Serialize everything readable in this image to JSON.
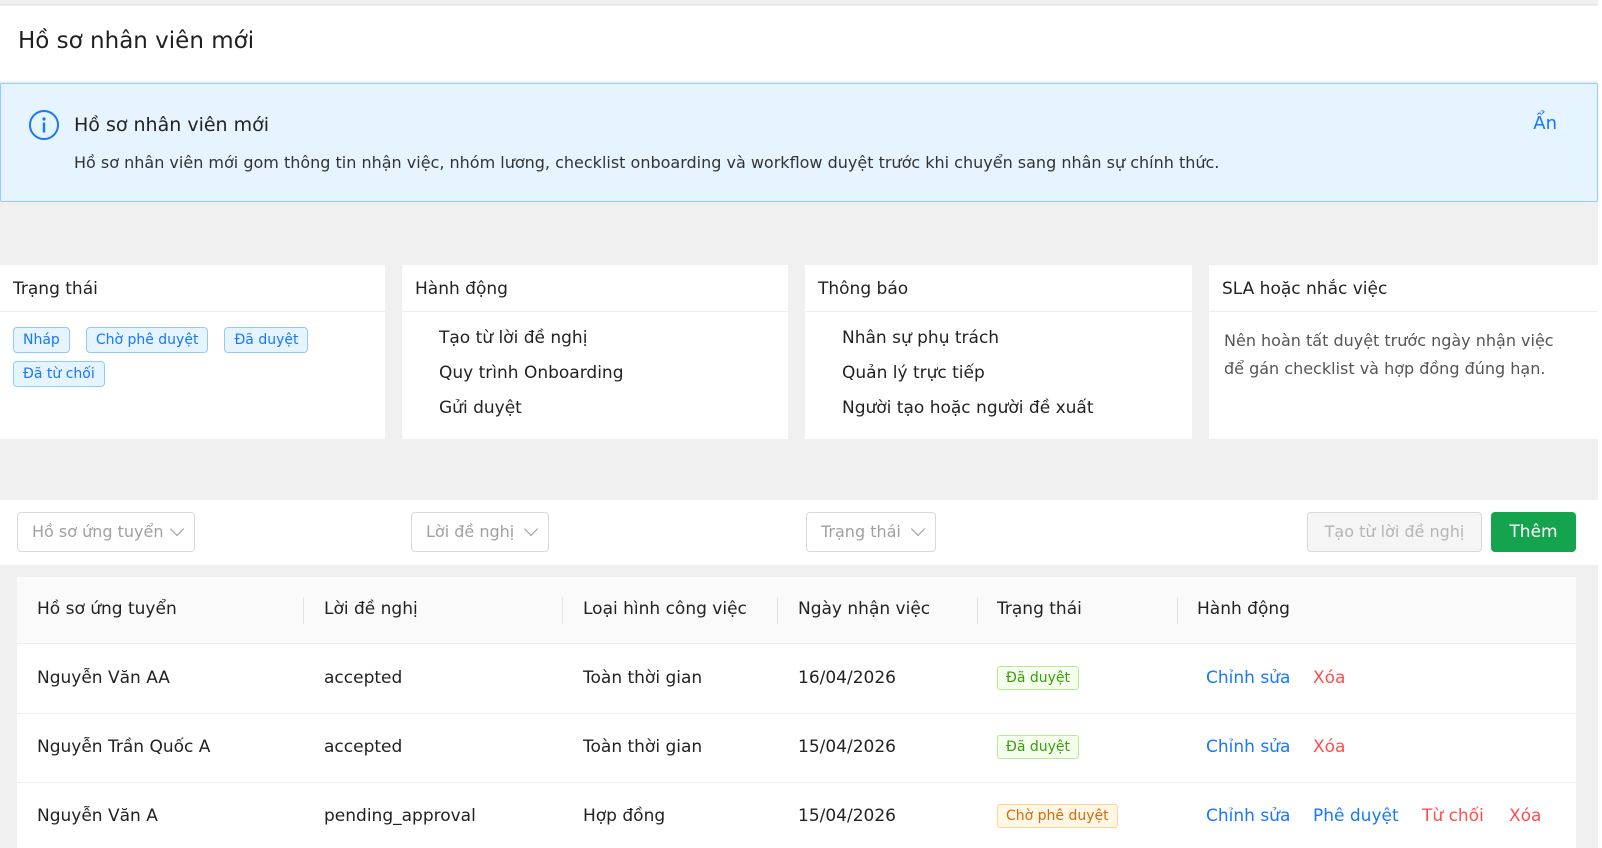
{
  "page": {
    "title": "Hồ sơ nhân viên mới"
  },
  "alert": {
    "title": "Hồ sơ nhân viên mới",
    "description": "Hồ sơ nhân viên mới gom thông tin nhận việc, nhóm lương, checklist onboarding và workflow duyệt trước khi chuyển sang nhân sự chính thức.",
    "hide_label": "Ẩn",
    "icon": "info-icon"
  },
  "cards": {
    "status": {
      "title": "Trạng thái",
      "tags": [
        "Nháp",
        "Chờ phê duyệt",
        "Đã duyệt",
        "Đã từ chối"
      ]
    },
    "actions": {
      "title": "Hành động",
      "items": [
        "Tạo từ lời đề nghị",
        "Quy trình Onboarding",
        "Gửi duyệt"
      ]
    },
    "notify": {
      "title": "Thông báo",
      "items": [
        "Nhân sự phụ trách",
        "Quản lý trực tiếp",
        "Người tạo hoặc người đề xuất"
      ]
    },
    "sla": {
      "title": "SLA hoặc nhắc việc",
      "text": "Nên hoàn tất duyệt trước ngày nhận việc để gán checklist và hợp đồng đúng hạn."
    }
  },
  "filters": {
    "candidate_placeholder": "Hồ sơ ứng tuyển",
    "offer_placeholder": "Lời đề nghị",
    "status_placeholder": "Trạng thái",
    "create_from_offer": "Tạo từ lời đề nghị",
    "add": "Thêm"
  },
  "table": {
    "columns": [
      "Hồ sơ ứng tuyển",
      "Lời đề nghị",
      "Loại hình công việc",
      "Ngày nhận việc",
      "Trạng thái",
      "Hành động"
    ],
    "rows": [
      {
        "candidate": "Nguyễn Văn AA",
        "offer": "accepted",
        "type": "Toàn thời gian",
        "date": "16/04/2026",
        "status": "Đã duyệt",
        "actions": [
          "Chỉnh sửa",
          "Xóa"
        ]
      },
      {
        "candidate": "Nguyễn Trần Quốc A",
        "offer": "accepted",
        "type": "Toàn thời gian",
        "date": "15/04/2026",
        "status": "Đã duyệt",
        "actions": [
          "Chỉnh sửa",
          "Xóa"
        ]
      },
      {
        "candidate": "Nguyễn Văn A",
        "offer": "pending_approval",
        "type": "Hợp đồng",
        "date": "15/04/2026",
        "status": "Chờ phê duyệt",
        "actions": [
          "Chỉnh sửa",
          "Phê duyệt",
          "Từ chối",
          "Xóa"
        ]
      }
    ]
  },
  "colors": {
    "primary": "#1677ff",
    "success": "#14a44d",
    "danger": "#ff4d4f",
    "alert_bg": "#e6f4ff"
  }
}
